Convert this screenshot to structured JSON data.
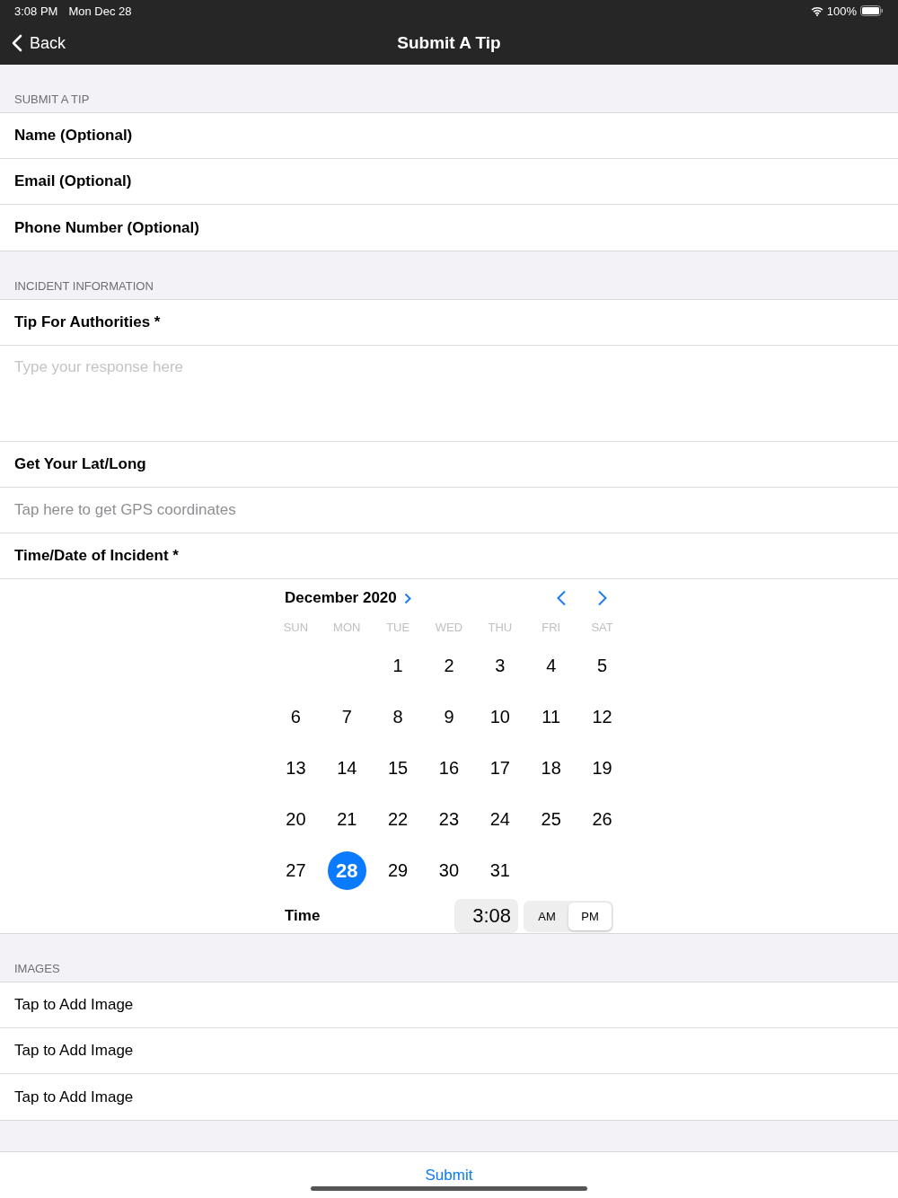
{
  "status_bar": {
    "time": "3:08 PM",
    "date": "Mon Dec 28",
    "battery": "100%"
  },
  "nav": {
    "back": "Back",
    "title": "Submit A Tip"
  },
  "sections": [
    {
      "header": "SUBMIT A TIP",
      "rows": [
        {
          "kind": "label",
          "text": "Name (Optional)"
        },
        {
          "kind": "label",
          "text": "Email (Optional)"
        },
        {
          "kind": "label",
          "text": "Phone Number (Optional)"
        }
      ]
    },
    {
      "header": "INCIDENT INFORMATION",
      "rows": [
        {
          "kind": "label",
          "text": "Tip For Authorities *"
        },
        {
          "kind": "textarea",
          "placeholder": "Type your response here"
        },
        {
          "kind": "label",
          "text": "Get Your Lat/Long"
        },
        {
          "kind": "action",
          "text": "Tap here to get GPS coordinates"
        },
        {
          "kind": "label",
          "text": "Time/Date of Incident *"
        },
        {
          "kind": "datepicker"
        }
      ]
    },
    {
      "header": "IMAGES",
      "rows": [
        {
          "kind": "plain",
          "text": "Tap to Add Image"
        },
        {
          "kind": "plain",
          "text": "Tap to Add Image"
        },
        {
          "kind": "plain",
          "text": "Tap to Add Image"
        }
      ]
    }
  ],
  "calendar": {
    "month": "December 2020",
    "weekdays": [
      "SUN",
      "MON",
      "TUE",
      "WED",
      "THU",
      "FRI",
      "SAT"
    ],
    "weeks": [
      {
        "kind": "offset",
        "days": [
          {
            "label": "1",
            "selected": false
          },
          {
            "label": "2",
            "selected": false
          },
          {
            "label": "3",
            "selected": false
          },
          {
            "label": "4",
            "selected": false
          },
          {
            "label": "5",
            "selected": false
          }
        ]
      },
      {
        "days": [
          {
            "label": "6",
            "selected": false
          },
          {
            "label": "7",
            "selected": false
          },
          {
            "label": "8",
            "selected": false
          },
          {
            "label": "9",
            "selected": false
          },
          {
            "label": "10",
            "selected": false
          },
          {
            "label": "11",
            "selected": false
          },
          {
            "label": "12",
            "selected": false
          }
        ]
      },
      {
        "days": [
          {
            "label": "13",
            "selected": false
          },
          {
            "label": "14",
            "selected": false
          },
          {
            "label": "15",
            "selected": false
          },
          {
            "label": "16",
            "selected": false
          },
          {
            "label": "17",
            "selected": false
          },
          {
            "label": "18",
            "selected": false
          },
          {
            "label": "19",
            "selected": false
          }
        ]
      },
      {
        "days": [
          {
            "label": "20",
            "selected": false
          },
          {
            "label": "21",
            "selected": false
          },
          {
            "label": "22",
            "selected": false
          },
          {
            "label": "23",
            "selected": false
          },
          {
            "label": "24",
            "selected": false
          },
          {
            "label": "25",
            "selected": false
          },
          {
            "label": "26",
            "selected": false
          }
        ]
      },
      {
        "days": [
          {
            "label": "27",
            "selected": false
          },
          {
            "label": "28",
            "selected": true
          },
          {
            "label": "29",
            "selected": false
          },
          {
            "label": "30",
            "selected": false
          },
          {
            "label": "31",
            "selected": false
          }
        ]
      }
    ],
    "time_label": "Time",
    "time": "3:08",
    "periods": [
      {
        "label": "AM",
        "selected": false
      },
      {
        "label": "PM",
        "selected": true
      }
    ]
  },
  "submit": "Submit"
}
